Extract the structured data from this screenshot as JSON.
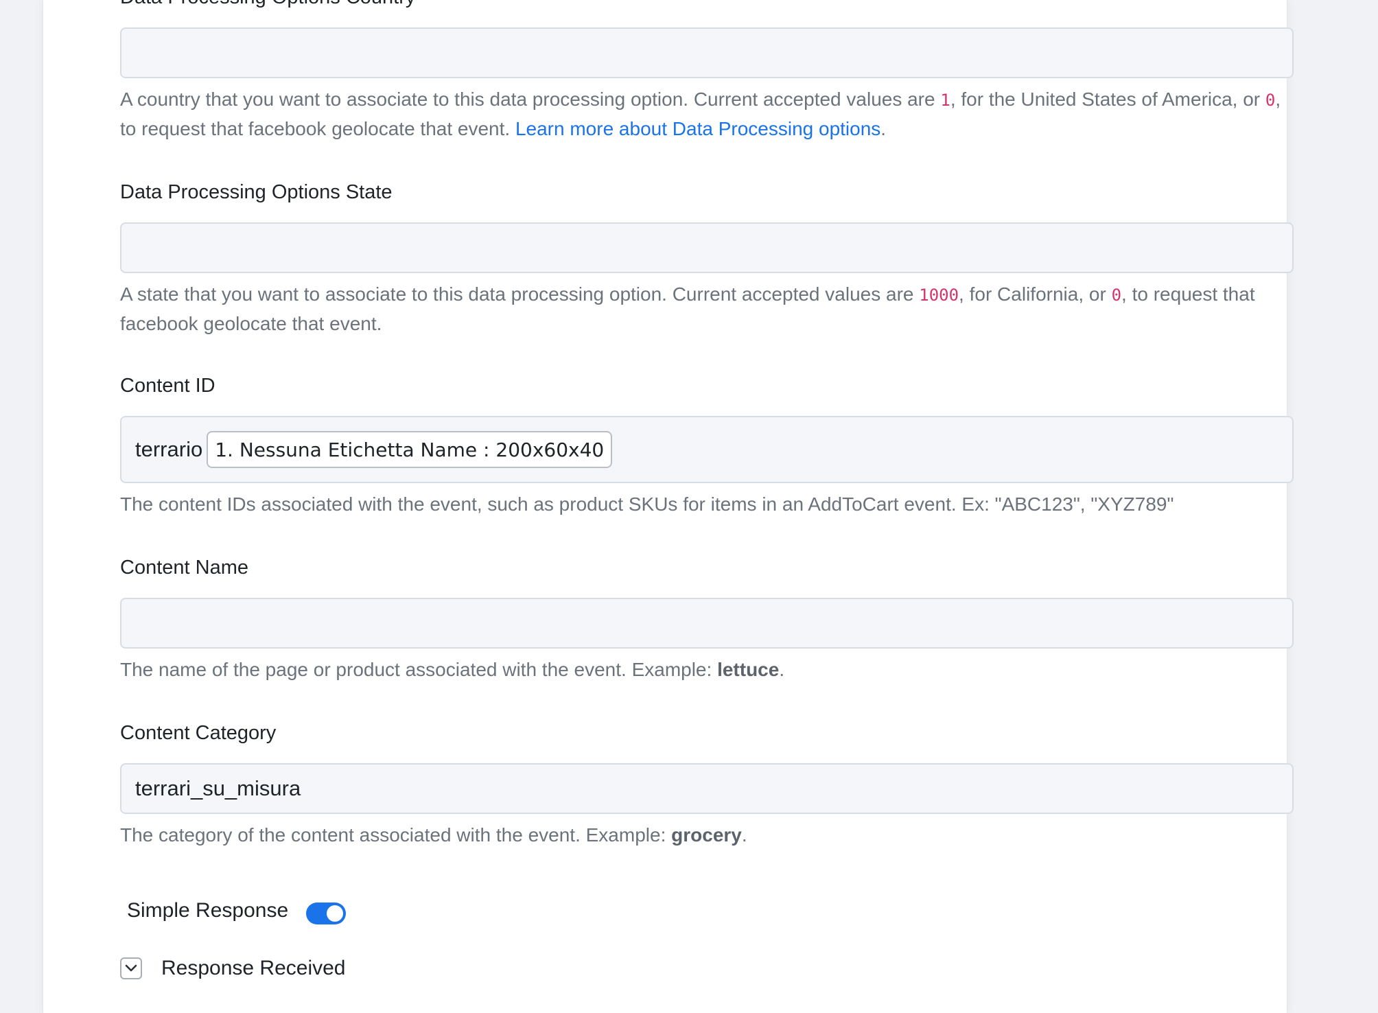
{
  "fields": {
    "country": {
      "label": "Data Processing Options Country",
      "value": "",
      "help_pre": "A country that you want to associate to this data processing option. Current accepted values are ",
      "code1": "1",
      "help_mid": ", for the United States of America, or ",
      "code2": "0",
      "help_post": ", to request that facebook geolocate that event. ",
      "link": "Learn more about Data Processing options",
      "help_end": "."
    },
    "state": {
      "label": "Data Processing Options State",
      "value": "",
      "help_pre": "A state that you want to associate to this data processing option. Current accepted values are ",
      "code1": "1000",
      "help_mid": ", for California, or ",
      "code2": "0",
      "help_post": ", to request that facebook geolocate that event."
    },
    "content_id": {
      "label": "Content ID",
      "prefix": "terrario",
      "chip": "1. Nessuna Etichetta Name : 200x60x40",
      "help": "The content IDs associated with the event, such as product SKUs for items in an AddToCart event. Ex: \"ABC123\", \"XYZ789\""
    },
    "content_name": {
      "label": "Content Name",
      "value": "",
      "help_pre": "The name of the page or product associated with the event. Example: ",
      "example": "lettuce",
      "help_end": "."
    },
    "content_category": {
      "label": "Content Category",
      "value": "terrari_su_misura",
      "help_pre": "The category of the content associated with the event. Example: ",
      "example": "grocery",
      "help_end": "."
    }
  },
  "simple_response": {
    "label": "Simple Response",
    "enabled": true
  },
  "response_received": {
    "label": "Response Received",
    "icon": "chevron-down-icon"
  },
  "colors": {
    "accent": "#1a73e8",
    "code": "#d6336c"
  }
}
